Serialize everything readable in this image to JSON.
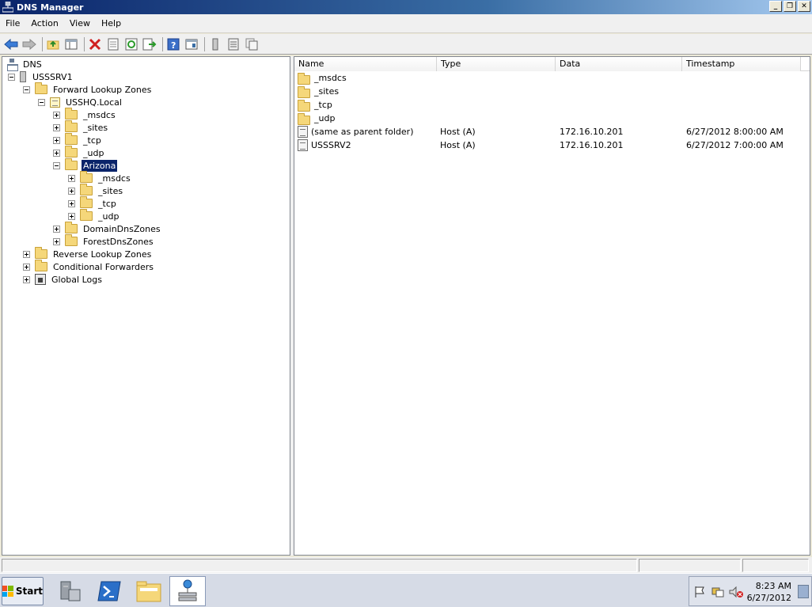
{
  "window": {
    "title": "DNS Manager",
    "min": "_",
    "restore": "❐",
    "close": "✕"
  },
  "menu": [
    "File",
    "Action",
    "View",
    "Help"
  ],
  "tree": {
    "root": "DNS",
    "server": "USSSRV1",
    "forward_zones": "Forward Lookup Zones",
    "zone": "USSHQ.Local",
    "zone_children": [
      "_msdcs",
      "_sites",
      "_tcp",
      "_udp"
    ],
    "selected": "Arizona",
    "selected_children": [
      "_msdcs",
      "_sites",
      "_tcp",
      "_udp"
    ],
    "zone_tail": [
      "DomainDnsZones",
      "ForestDnsZones"
    ],
    "server_tail": [
      "Reverse Lookup Zones",
      "Conditional Forwarders",
      "Global Logs"
    ]
  },
  "list": {
    "columns": [
      "Name",
      "Type",
      "Data",
      "Timestamp"
    ],
    "folders": [
      "_msdcs",
      "_sites",
      "_tcp",
      "_udp"
    ],
    "records": [
      {
        "name": "(same as parent folder)",
        "type": "Host (A)",
        "data": "172.16.10.201",
        "timestamp": "6/27/2012 8:00:00 AM"
      },
      {
        "name": "USSSRV2",
        "type": "Host (A)",
        "data": "172.16.10.201",
        "timestamp": "6/27/2012 7:00:00 AM"
      }
    ]
  },
  "taskbar": {
    "start": "Start",
    "time": "8:23 AM",
    "date": "6/27/2012"
  },
  "colors": {
    "selection": "#0a246a",
    "titlebar": "#0a246a",
    "folder": "#f5d77a"
  }
}
